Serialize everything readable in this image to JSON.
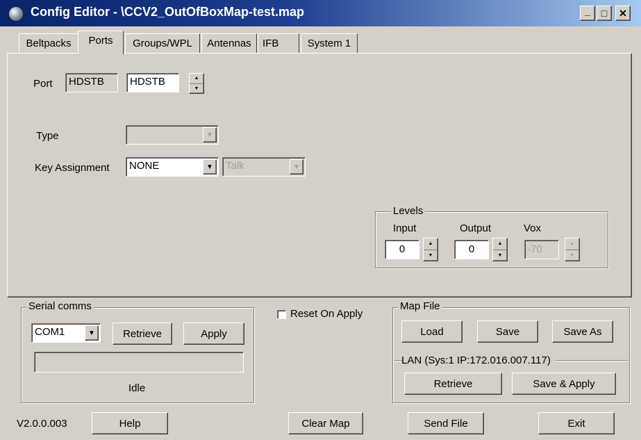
{
  "window": {
    "title": "Config Editor - \\CCV2_OutOfBoxMap-test.map",
    "min_label": "_",
    "max_label": "□",
    "close_label": "✕"
  },
  "tabs": [
    {
      "label": "Beltpacks",
      "active": false
    },
    {
      "label": "Ports",
      "active": true
    },
    {
      "label": "Groups/WPL",
      "active": false
    },
    {
      "label": "Antennas",
      "active": false
    },
    {
      "label": "IFB",
      "active": false
    },
    {
      "label": "System 1",
      "active": false
    }
  ],
  "ports": {
    "port_label": "Port",
    "port_readonly_value": "HDSTB",
    "port_edit_value": "HDSTB",
    "type_label": "Type",
    "type_value": "",
    "key_assignment_label": "Key Assignment",
    "key_assignment_value": "NONE",
    "key_mode_value": "Talk",
    "levels": {
      "title": "Levels",
      "input_label": "Input",
      "input_value": "0",
      "output_label": "Output",
      "output_value": "0",
      "vox_label": "Vox",
      "vox_value": "-70"
    }
  },
  "serial_comms": {
    "title": "Serial comms",
    "port_value": "COM1",
    "retrieve_label": "Retrieve",
    "apply_label": "Apply",
    "progress_text": "",
    "status": "Idle"
  },
  "reset_on_apply": {
    "label": "Reset On Apply",
    "checked": false
  },
  "map_file": {
    "title": "Map File",
    "load_label": "Load",
    "save_label": "Save",
    "save_as_label": "Save As",
    "lan_title": "LAN  (Sys:1 IP:172.016.007.117)",
    "lan_retrieve_label": "Retrieve",
    "lan_save_apply_label": "Save & Apply"
  },
  "footer": {
    "version": "V2.0.0.003",
    "help_label": "Help",
    "clear_map_label": "Clear Map",
    "send_file_label": "Send File",
    "exit_label": "Exit"
  },
  "icons": {
    "arrow_down": "▼",
    "spin_up": "▲",
    "spin_down": "▼"
  }
}
